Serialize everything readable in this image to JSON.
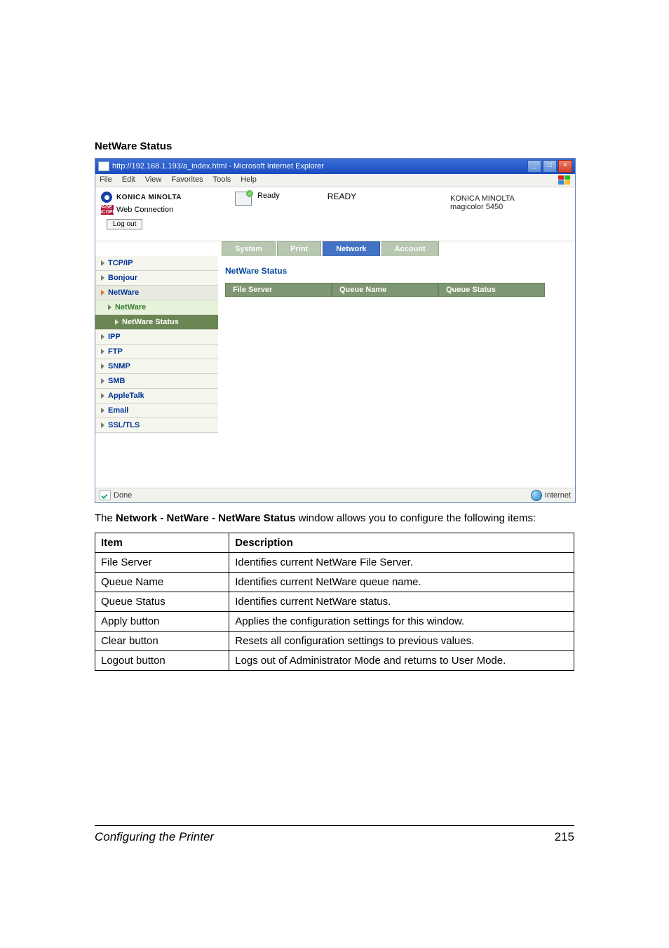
{
  "heading": "NetWare Status",
  "ie": {
    "title": "http://192.168.1.193/a_index.html - Microsoft Internet Explorer",
    "menu": [
      "File",
      "Edit",
      "View",
      "Favorites",
      "Tools",
      "Help"
    ],
    "min": "_",
    "max": "□",
    "close": "×",
    "status_done": "Done",
    "status_zone": "Internet"
  },
  "header": {
    "brand": "KONICA MINOLTA",
    "scope_logo": "PAGE SCOPE",
    "scope_text": "Web Connection",
    "ready_label": "Ready",
    "ready_status": "READY",
    "right_line1": "KONICA MINOLTA",
    "right_line2": "magicolor 5450",
    "logout": "Log out"
  },
  "tabs": {
    "system": "System",
    "print": "Print",
    "network": "Network",
    "account": "Account"
  },
  "sidebar": {
    "tcpip": "TCP/IP",
    "bonjour": "Bonjour",
    "netware": "NetWare",
    "netware_sub": "NetWare",
    "netware_status": "NetWare Status",
    "ipp": "IPP",
    "ftp": "FTP",
    "snmp": "SNMP",
    "smb": "SMB",
    "appletalk": "AppleTalk",
    "email": "Email",
    "ssltls": "SSL/TLS"
  },
  "content": {
    "title": "NetWare Status",
    "cols": {
      "file_server": "File Server",
      "queue_name": "Queue Name",
      "queue_status": "Queue Status"
    }
  },
  "caption_pre": "The ",
  "caption_bold": "Network - NetWare - NetWare Status",
  "caption_post": " window allows you to configure the following items:",
  "table": {
    "head_item": "Item",
    "head_desc": "Description",
    "rows": [
      {
        "item": "File Server",
        "desc": "Identifies current NetWare File Server."
      },
      {
        "item": "Queue Name",
        "desc": "Identifies current NetWare queue name."
      },
      {
        "item": "Queue Status",
        "desc": "Identifies current NetWare status."
      },
      {
        "item": "Apply button",
        "desc": "Applies the configuration settings for this window."
      },
      {
        "item": "Clear button",
        "desc": "Resets all configuration settings to previous values."
      },
      {
        "item": "Logout button",
        "desc": "Logs out of Administrator Mode and returns to User Mode."
      }
    ]
  },
  "footer": {
    "left": "Configuring the Printer",
    "right": "215"
  }
}
